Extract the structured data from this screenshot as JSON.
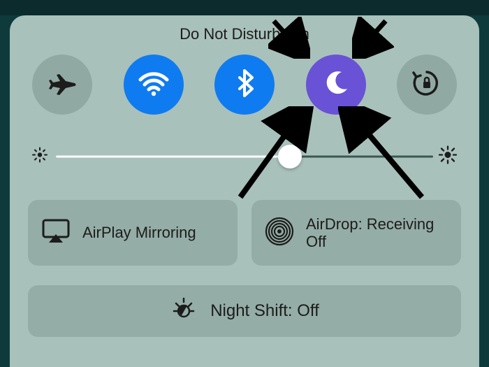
{
  "title": "Do Not Disturb: On",
  "toggles": {
    "airplane": {
      "on": false
    },
    "wifi": {
      "on": true
    },
    "bluetooth": {
      "on": true
    },
    "dnd": {
      "on": true
    },
    "rotation_lock": {
      "on": false
    }
  },
  "brightness": {
    "percent": 62
  },
  "airplay": {
    "label": "AirPlay Mirroring"
  },
  "airdrop": {
    "label": "AirDrop: Receiving Off"
  },
  "nightshift": {
    "label": "Night Shift: Off"
  },
  "colors": {
    "panel": "#a9c1bb",
    "toggle_off": "#90aaa3",
    "toggle_on_blue": "#0f7bf0",
    "toggle_on_purple": "#6a52d6",
    "wide_button": "#94ada6"
  }
}
